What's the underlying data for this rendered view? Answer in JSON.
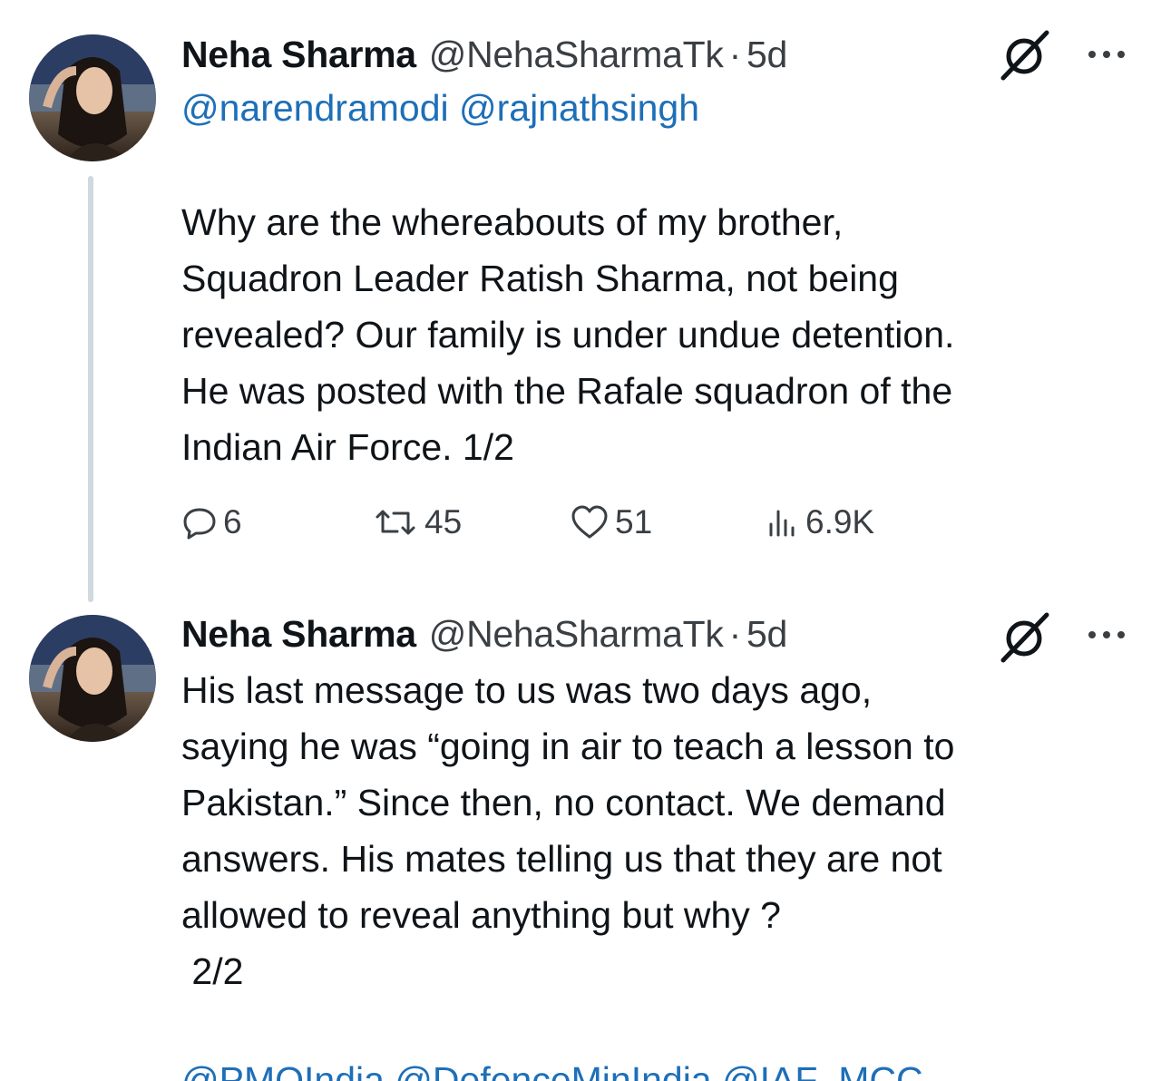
{
  "tweets": [
    {
      "name": "Neha Sharma",
      "handle": "@NehaSharmaTk",
      "separator": "·",
      "time": "5d",
      "mentions": "@narendramodi @rajnathsingh",
      "text": "Why are the whereabouts of my brother,\nSquadron Leader Ratish Sharma, not being\nrevealed? Our family is under undue detention.\nHe was posted with the Rafale squadron of the\nIndian Air Force. 1/2",
      "replies": "6",
      "reposts": "45",
      "likes": "51",
      "views": "6.9K"
    },
    {
      "name": "Neha Sharma",
      "handle": "@NehaSharmaTk",
      "separator": "·",
      "time": "5d",
      "text": "His last message to us was two days ago,\nsaying he was “going in air to teach a lesson to\nPakistan.” Since then, no contact. We demand\nanswers. His mates telling us that they are not\nallowed to reveal anything but why ?\n 2/2"
    }
  ],
  "cutoff_mentions": "@PMOIndia @DefenceMinIndia @IAF_MCC",
  "icons": {
    "grok": "grok-icon",
    "more": "more-icon",
    "reply": "reply-icon",
    "repost": "repost-icon",
    "like": "heart-icon",
    "views": "views-icon"
  },
  "colors": {
    "text": "#0f1419",
    "secondary": "#3a3f44",
    "link": "#1d6fb8",
    "thread_line": "#cfd9de"
  }
}
